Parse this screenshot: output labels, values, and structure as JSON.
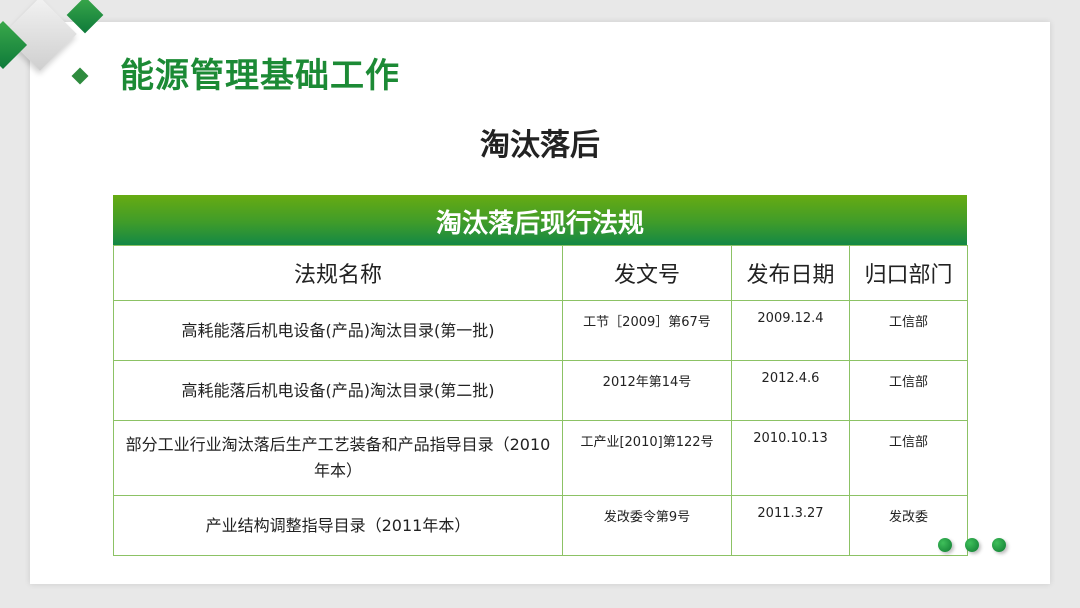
{
  "page": {
    "title": "能源管理基础工作",
    "subtitle": "淘汰落后"
  },
  "table": {
    "banner": "淘汰落后现行法规",
    "headers": [
      "法规名称",
      "发文号",
      "发布日期",
      "归口部门"
    ],
    "rows": [
      {
        "name": "高耗能落后机电设备(产品)淘汰目录(第一批)",
        "doc_no": "工节［2009］第67号",
        "date": "2009.12.4",
        "dept": "工信部"
      },
      {
        "name": "高耗能落后机电设备(产品)淘汰目录(第二批)",
        "doc_no": "2012年第14号",
        "date": "2012.4.6",
        "dept": "工信部"
      },
      {
        "name": "部分工业行业淘汰落后生产工艺装备和产品指导目录（2010年本）",
        "doc_no": "工产业[2010]第122号",
        "date": "2010.10.13",
        "dept": "工信部"
      },
      {
        "name": "产业结构调整指导目录（2011年本）",
        "doc_no": "发改委令第9号",
        "date": "2011.3.27",
        "dept": "发改委"
      }
    ]
  },
  "colors": {
    "title_green": "#1c8a35",
    "banner_top": "#67ab12",
    "banner_bottom": "#138845",
    "border": "#8cc265"
  }
}
